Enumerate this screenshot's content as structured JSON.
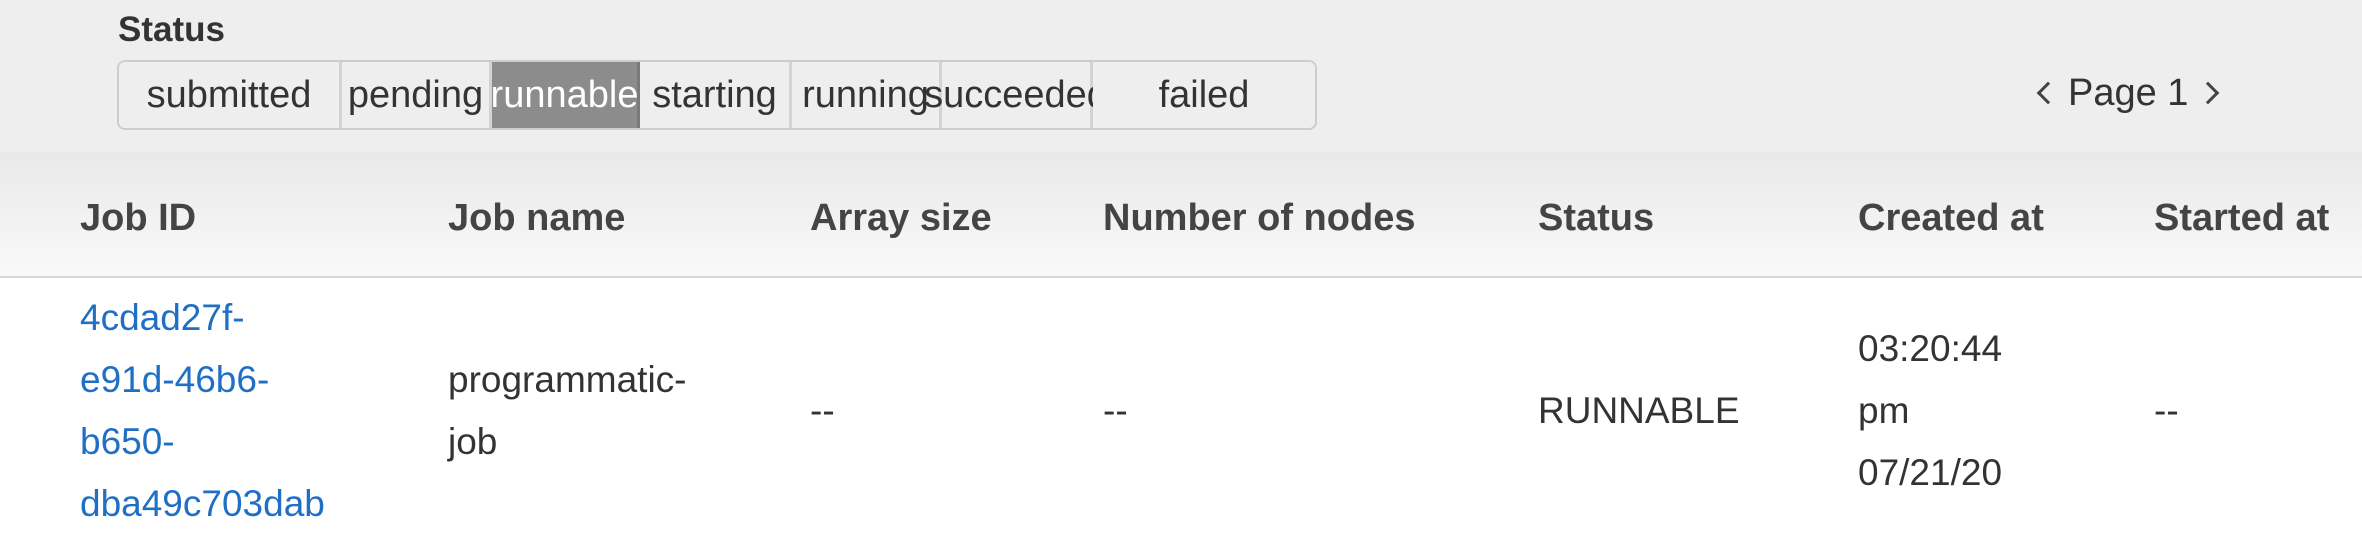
{
  "filters": {
    "label": "Status",
    "statuses": [
      "submitted",
      "pending",
      "runnable",
      "starting",
      "running",
      "succeeded",
      "failed"
    ],
    "active": "runnable"
  },
  "pagination": {
    "prev_icon": "chevron-left-icon",
    "text": "Page 1",
    "next_icon": "chevron-right-icon"
  },
  "table": {
    "columns": [
      "Job ID",
      "Job name",
      "Array size",
      "Number of nodes",
      "Status",
      "Created at",
      "Started at"
    ],
    "rows": [
      {
        "job_id_lines": [
          "4cdad27f-",
          "e91d-46b6-",
          "b650-",
          "dba49c703dab"
        ],
        "job_name_lines": [
          "programmatic-",
          "job"
        ],
        "array_size": "--",
        "number_of_nodes": "--",
        "status": "RUNNABLE",
        "created_at_lines": [
          "03:20:44",
          "pm",
          "07/21/20"
        ],
        "started_at": "--"
      }
    ]
  },
  "colors": {
    "active_filter_bg": "#8c8c8c",
    "link": "#1f6fc5",
    "header_bg": "#eeeeee"
  }
}
